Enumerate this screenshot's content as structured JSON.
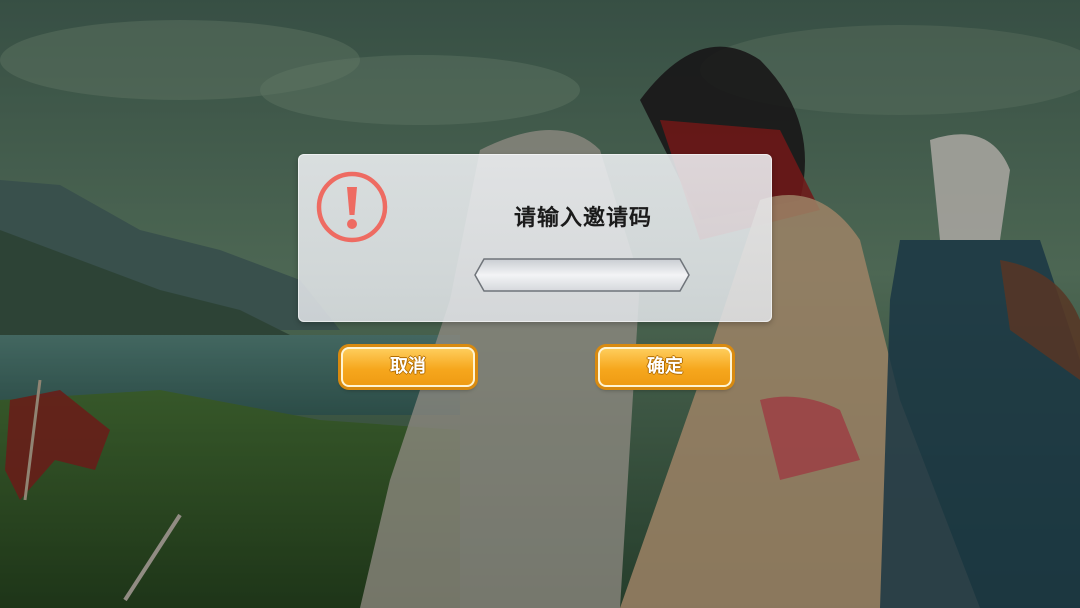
{
  "dialog": {
    "title": "请输入邀请码",
    "icon": "exclamation-circle-icon",
    "accent_color": "#ee6b62",
    "invite_code_input": {
      "value": "",
      "placeholder": ""
    }
  },
  "buttons": {
    "cancel_label": "取消",
    "confirm_label": "确定",
    "color": "#f6a71d"
  }
}
